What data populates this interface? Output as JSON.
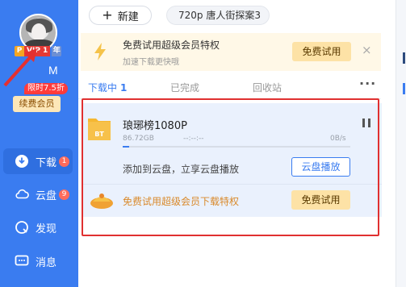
{
  "sidebar": {
    "vip_prefix": "P",
    "vip_label": "VIP 1",
    "vip_suffix": "年",
    "username": "M",
    "promo_tag": "限时7.5折",
    "renew_button": "续费会员",
    "items": [
      {
        "label": "下载",
        "badge": "1",
        "icon": "download-icon"
      },
      {
        "label": "云盘",
        "badge": "9",
        "icon": "cloud-icon"
      },
      {
        "label": "发现",
        "icon": "discover-icon"
      },
      {
        "label": "消息",
        "icon": "message-icon"
      }
    ]
  },
  "toolbar": {
    "new_button": "新建",
    "search_value": "720p  唐人街探案3"
  },
  "banner": {
    "title": "免费试用超级会员特权",
    "subtitle": "加速下载更快哦",
    "button": "免费试用",
    "close": "×"
  },
  "tabs": [
    {
      "label": "下载中",
      "count": "1"
    },
    {
      "label": "已完成"
    },
    {
      "label": "回收站"
    }
  ],
  "more_label": "···",
  "task": {
    "name": "琅琊榜1080P",
    "folder_tag": "BT",
    "size": "86.72GB",
    "eta": "--:--:--",
    "speed": "0B/s",
    "progress": 0.03,
    "cloud_text": "添加到云盘，立享云盘播放",
    "cloud_button": "云盘播放",
    "promo_text": "免费试用超级会员下载特权",
    "promo_button": "免费试用"
  },
  "colors": {
    "sidebar": "#3a7cf0",
    "accent": "#3a7cf0",
    "highlight": "#e03030"
  }
}
